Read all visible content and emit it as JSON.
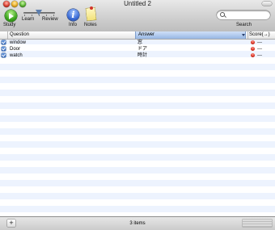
{
  "window": {
    "title": "Untitled 2"
  },
  "toolbar": {
    "study_label": "Study",
    "slider_left_label": "Learn",
    "slider_right_label": "Review",
    "info_label": "Info",
    "info_glyph": "i",
    "notes_label": "Notes",
    "search_label": "Search",
    "search_placeholder": ""
  },
  "table": {
    "columns": [
      "Question",
      "Answer",
      "Score(→)"
    ],
    "rows": [
      {
        "checked": true,
        "question": "window",
        "answer": "窓",
        "score": "---"
      },
      {
        "checked": true,
        "question": "Door",
        "answer": "ドア",
        "score": "---"
      },
      {
        "checked": true,
        "question": "watch",
        "answer": "時計",
        "score": "---"
      }
    ]
  },
  "statusbar": {
    "add_label": "+",
    "item_count": "3 items"
  },
  "colors": {
    "stripe": "#edf3fe",
    "selected_header": "#97b7e4",
    "study_green": "#3aa41c",
    "info_blue": "#3c6cd6",
    "score_red": "#d42b1c"
  },
  "icons": [
    "close-icon",
    "minimize-icon",
    "zoom-icon",
    "play-icon",
    "info-icon",
    "notes-icon",
    "search-icon",
    "checkbox-icon",
    "score-dot-icon",
    "add-icon"
  ]
}
